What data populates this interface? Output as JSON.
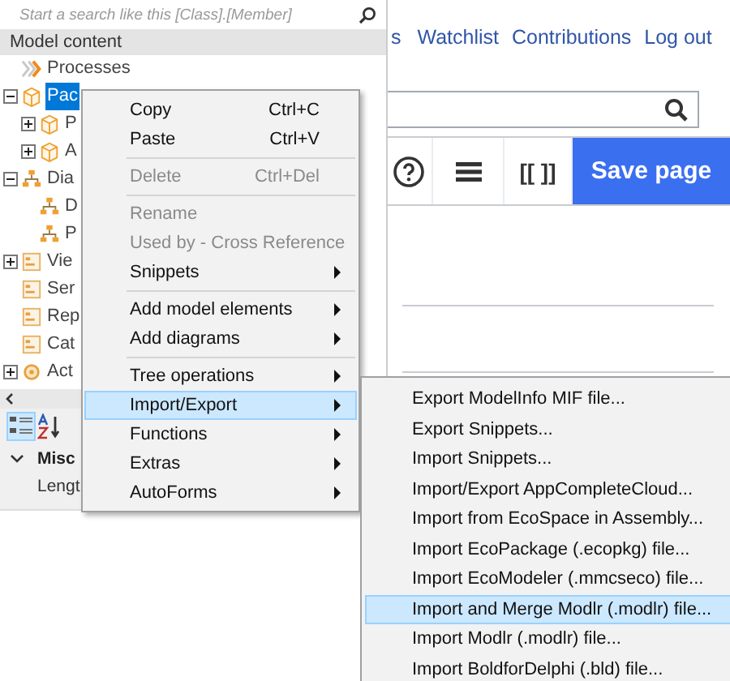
{
  "page": {
    "nav_links": [
      "s",
      "Watchlist",
      "Contributions",
      "Log out"
    ],
    "toolbar": {
      "save_button": "Save page",
      "link_button": "[[ ]]"
    }
  },
  "model_panel": {
    "search": {
      "placeholder": "Start a search like this [Class].[Member]"
    },
    "header": "Model content",
    "tree": [
      {
        "label": "Processes",
        "kind": "process"
      },
      {
        "label": "Pac",
        "kind": "package",
        "expanded": true,
        "selected": true,
        "children": [
          {
            "label": "P",
            "kind": "package",
            "expanded": false,
            "selected": false
          },
          {
            "label": "A",
            "kind": "package",
            "expanded": false,
            "selected": false
          }
        ]
      },
      {
        "label": "Dia",
        "kind": "diagram",
        "expanded": true,
        "selected": false,
        "children": [
          {
            "label": "D",
            "kind": "diagram",
            "selected": false
          },
          {
            "label": "P",
            "kind": "diagram",
            "selected": false
          }
        ]
      },
      {
        "label": "Vie",
        "kind": "view",
        "expanded": false,
        "selected": false
      },
      {
        "label": "Ser",
        "kind": "view",
        "selected": false
      },
      {
        "label": "Rep",
        "kind": "view",
        "selected": false
      },
      {
        "label": "Cat",
        "kind": "view",
        "selected": false
      },
      {
        "label": "Act",
        "kind": "action",
        "expanded": false,
        "selected": false
      }
    ],
    "properties": {
      "category": "Misc",
      "expanded": true,
      "rows": [
        "Lengt"
      ]
    }
  },
  "context_menu": [
    {
      "kind": "item",
      "label": "Copy",
      "shortcut": "Ctrl+C",
      "disabled": false,
      "submenu": false,
      "selected": false
    },
    {
      "kind": "item",
      "label": "Paste",
      "shortcut": "Ctrl+V",
      "disabled": false,
      "submenu": false,
      "selected": false
    },
    {
      "kind": "separator"
    },
    {
      "kind": "item",
      "label": "Delete",
      "shortcut": "Ctrl+Del",
      "disabled": true,
      "submenu": false,
      "selected": false
    },
    {
      "kind": "separator"
    },
    {
      "kind": "item",
      "label": "Rename",
      "disabled": true,
      "submenu": false,
      "selected": false
    },
    {
      "kind": "item",
      "label": "Used by - Cross Reference",
      "disabled": true,
      "submenu": false,
      "selected": false
    },
    {
      "kind": "item",
      "label": "Snippets",
      "disabled": false,
      "submenu": true,
      "selected": false
    },
    {
      "kind": "separator"
    },
    {
      "kind": "item",
      "label": "Add model elements",
      "disabled": false,
      "submenu": true,
      "selected": false
    },
    {
      "kind": "item",
      "label": "Add diagrams",
      "disabled": false,
      "submenu": true,
      "selected": false
    },
    {
      "kind": "separator"
    },
    {
      "kind": "item",
      "label": "Tree operations",
      "disabled": false,
      "submenu": true,
      "selected": false
    },
    {
      "kind": "item",
      "label": "Import/Export",
      "disabled": false,
      "submenu": true,
      "selected": true
    },
    {
      "kind": "item",
      "label": "Functions",
      "disabled": false,
      "submenu": true,
      "selected": false
    },
    {
      "kind": "item",
      "label": "Extras",
      "disabled": false,
      "submenu": true,
      "selected": false
    },
    {
      "kind": "item",
      "label": "AutoForms",
      "disabled": false,
      "submenu": true,
      "selected": false
    }
  ],
  "submenu": [
    {
      "label": "Export ModelInfo MIF file...",
      "selected": false
    },
    {
      "label": "Export Snippets...",
      "selected": false
    },
    {
      "label": "Import Snippets...",
      "selected": false
    },
    {
      "label": "Import/Export AppCompleteCloud...",
      "selected": false
    },
    {
      "label": "Import from EcoSpace in Assembly...",
      "selected": false
    },
    {
      "label": "Import EcoPackage (.ecopkg) file...",
      "selected": false
    },
    {
      "label": "Import EcoModeler (.mmcseco) file...",
      "selected": false
    },
    {
      "label": "Import and Merge Modlr (.modlr) file...",
      "selected": true
    },
    {
      "label": "Import Modlr (.modlr) file...",
      "selected": false
    },
    {
      "label": "Import BoldforDelphi (.bld) file...",
      "selected": false
    }
  ]
}
